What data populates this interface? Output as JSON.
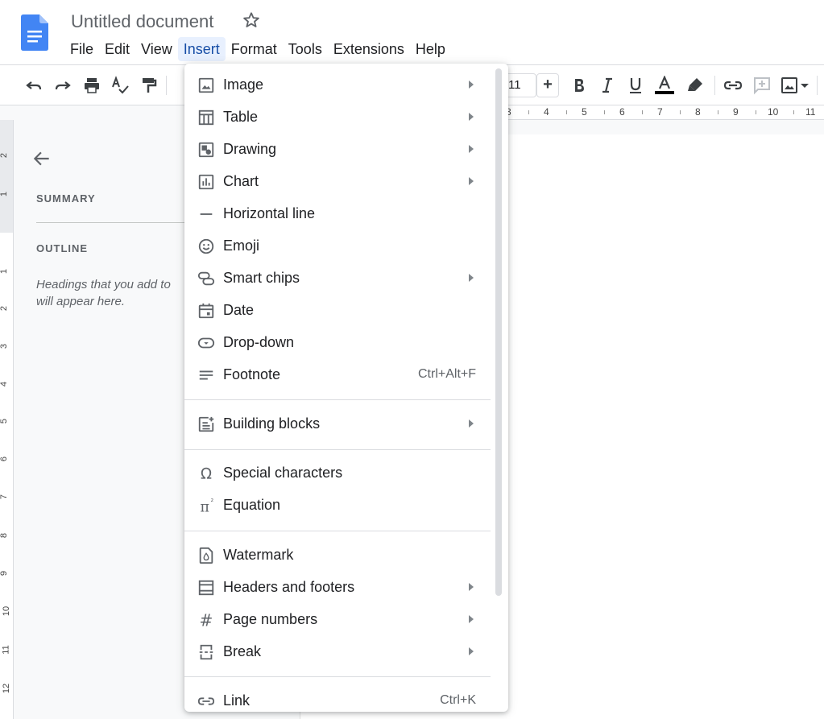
{
  "header": {
    "title": "Untitled document",
    "menus": [
      "File",
      "Edit",
      "View",
      "Insert",
      "Format",
      "Tools",
      "Extensions",
      "Help"
    ],
    "active_menu": "Insert"
  },
  "toolbar": {
    "font_size": "11",
    "plus": "+"
  },
  "ruler": {
    "top_numbers": [
      "3",
      "4",
      "5",
      "6",
      "7",
      "8",
      "9",
      "10",
      "11"
    ],
    "left_numbers": [
      "2",
      "1",
      "1",
      "2",
      "3",
      "4",
      "5",
      "6",
      "7",
      "8",
      "9",
      "10",
      "11",
      "12"
    ]
  },
  "outline_panel": {
    "summary": "SUMMARY",
    "outline": "OUTLINE",
    "hint_line1": "Headings that you add to",
    "hint_line2": "will appear here."
  },
  "insert_menu": {
    "items": [
      {
        "label": "Image",
        "icon": "image-icon",
        "submenu": true
      },
      {
        "label": "Table",
        "icon": "table-icon",
        "submenu": true
      },
      {
        "label": "Drawing",
        "icon": "drawing-icon",
        "submenu": true
      },
      {
        "label": "Chart",
        "icon": "chart-icon",
        "submenu": true
      },
      {
        "label": "Horizontal line",
        "icon": "horizontal-line-icon",
        "submenu": false
      },
      {
        "label": "Emoji",
        "icon": "emoji-icon",
        "submenu": false
      },
      {
        "label": "Smart chips",
        "icon": "smart-chips-icon",
        "submenu": true
      },
      {
        "label": "Date",
        "icon": "calendar-icon",
        "submenu": false
      },
      {
        "label": "Drop-down",
        "icon": "dropdown-icon",
        "submenu": false
      },
      {
        "label": "Footnote",
        "icon": "footnote-icon",
        "submenu": false,
        "shortcut": "Ctrl+Alt+F"
      },
      {
        "label": "Building blocks",
        "icon": "building-blocks-icon",
        "submenu": true
      },
      {
        "label": "Special characters",
        "icon": "omega-icon",
        "submenu": false
      },
      {
        "label": "Equation",
        "icon": "pi-icon",
        "submenu": false
      },
      {
        "label": "Watermark",
        "icon": "watermark-icon",
        "submenu": false
      },
      {
        "label": "Headers and footers",
        "icon": "headers-footers-icon",
        "submenu": true
      },
      {
        "label": "Page numbers",
        "icon": "hash-icon",
        "submenu": true
      },
      {
        "label": "Break",
        "icon": "break-icon",
        "submenu": true
      },
      {
        "label": "Link",
        "icon": "link-icon",
        "submenu": false,
        "shortcut": "Ctrl+K"
      }
    ],
    "pi_glyph": "π",
    "pi_sup": "²",
    "omega_glyph": "Ω",
    "hash_glyph": "#"
  },
  "colors": {
    "doc_blue": "#4285f4",
    "active_menu_bg": "#e8f0fe",
    "active_menu_text": "#174ea6",
    "icon_gray": "#5f6368"
  }
}
